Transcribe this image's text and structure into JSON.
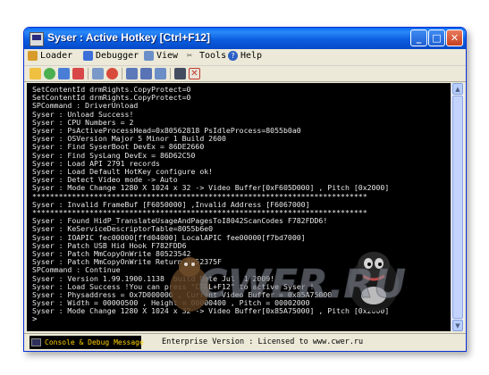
{
  "window": {
    "title": "Syser : Active Hotkey [Ctrl+F12]"
  },
  "menu": [
    {
      "label": "Loader",
      "icon": "loader-icon"
    },
    {
      "label": "Debugger",
      "icon": "debugger-icon"
    },
    {
      "label": "View",
      "icon": "view-icon"
    },
    {
      "label": "Tools",
      "icon": "tools-icon"
    },
    {
      "label": "Help",
      "icon": "help-icon"
    }
  ],
  "toolbar_icons": [
    "open-icon",
    "reload-icon",
    "save-icon",
    "bookmark-icon",
    "chart-icon",
    "disk-icon",
    "debug-icon",
    "window-icon",
    "window2-icon",
    "terminal-icon",
    "stop-icon"
  ],
  "console_lines": [
    "SetContentId drmRights.CopyProtect=0",
    "SetContentId drmRights.CopyProtect=0",
    "SPCommand : DriverUnload",
    "Syser : Unload Success!",
    "Syser : CPU Numbers = 2",
    "Syser : PsActiveProcessHead=0x80562818 PsIdleProcess=8055b0a0",
    "Syser : OSVersion Major 5 Minor 1 Build 2600",
    "Syser : Find SyserBoot DevEx = 86DE2660",
    "Syser : Find SysLang DevEx = 86D62C50",
    "Syser : Load API 2791 records",
    "Syser : Load Default HotKey configure ok!",
    "Syser : Detect Video mode -> Auto",
    "Syser : Mode Change 1280 X 1024 x 32 -> Video Buffer[0xF605D000] , Pitch [0x2000]",
    "****************************************************************************",
    "Syser : Invalid FrameBuf [F6050000] ,Invalid Address [F6067000]",
    "****************************************************************************",
    "Syser : Found HidP_TranslateUsageAndPagesToI8042ScanCodes F782FDD6!",
    "Syser : KeServiceDescriptorTable=8055b6e0",
    "Syser : IOAPIC fec00000[ffd04000] LocalAPIC fee00000[f7bd7000]",
    "Syser : Patch USB Hid Hook F782FDD6",
    "Syser : Patch MmCopyOnWrite 80523542",
    "Syser : Patch MmCopyOnWrite Return 8052375F",
    "SPCommand : Continue",
    "Syser : Version 1.99.1900.1138  build Date Jul  1 2009!",
    "Syser : Load Success !You can press \"CTRL+F12\" to active Syser !",
    "Syser : Physaddress = 0x7D000000 , Current Video Buffer = 0x85A75000",
    "Syser : Width = 00000500 , Height = 00000400 , Pitch = 00002000",
    "Syser : Mode Change 1280 X 1024 x 32 -> Video Buffer[0x85A75000] , Pitch [0x2000]"
  ],
  "prompt": ">",
  "status": {
    "tab_label": "Console & Debug Message",
    "info": "Enterprise Version : Licensed to www.cwer.ru"
  },
  "watermark": {
    "text": "CWER.RU"
  }
}
